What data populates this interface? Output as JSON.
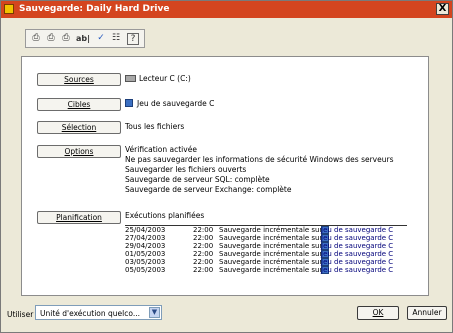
{
  "window": {
    "title": "Sauvegarde: Daily Hard Drive",
    "close": "X"
  },
  "toolbar": {
    "buttons": [
      {
        "icon": "new-icon",
        "glyph": "⎙"
      },
      {
        "icon": "copy-icon",
        "glyph": "⎙"
      },
      {
        "icon": "paste-icon",
        "glyph": "⎙"
      },
      {
        "icon": "rename-icon",
        "glyph": "ab|"
      },
      {
        "icon": "check-icon",
        "glyph": "✓"
      },
      {
        "icon": "properties-icon",
        "glyph": "☷"
      },
      {
        "icon": "help-icon",
        "glyph": "?"
      }
    ]
  },
  "sections": {
    "sources": {
      "button": "Sources",
      "text": "Lecteur C (C:)"
    },
    "cibles": {
      "button": "Cibles",
      "text": "Jeu de sauvegarde C"
    },
    "selection": {
      "button": "Sélection",
      "text": "Tous les fichiers"
    },
    "options": {
      "button": "Options",
      "lines": [
        "Vérification activée",
        "Ne pas sauvegarder les informations de sécurité Windows des serveurs",
        "Sauvegarder les fichiers ouverts",
        "Sauvegarde de serveur SQL: complète",
        "Sauvegarde de serveur Exchange: complète"
      ]
    },
    "planification": {
      "button": "Planification",
      "heading": "Exécutions planifiées",
      "rows": [
        {
          "date": "25/04/2003",
          "time": "22:00",
          "desc": "Sauvegarde incrémentale sur",
          "set": "Jeu de sauvegarde C"
        },
        {
          "date": "27/04/2003",
          "time": "22:00",
          "desc": "Sauvegarde incrémentale sur",
          "set": "Jeu de sauvegarde C"
        },
        {
          "date": "29/04/2003",
          "time": "22:00",
          "desc": "Sauvegarde incrémentale sur",
          "set": "Jeu de sauvegarde C"
        },
        {
          "date": "01/05/2003",
          "time": "22:00",
          "desc": "Sauvegarde incrémentale sur",
          "set": "Jeu de sauvegarde C"
        },
        {
          "date": "03/05/2003",
          "time": "22:00",
          "desc": "Sauvegarde incrémentale sur",
          "set": "Jeu de sauvegarde C"
        },
        {
          "date": "05/05/2003",
          "time": "22:00",
          "desc": "Sauvegarde incrémentale sur",
          "set": "Jeu de sauvegarde C"
        }
      ]
    }
  },
  "footer": {
    "use_label": "Utiliser",
    "combo_value": "Unité d'exécution quelco...",
    "ok": "OK",
    "cancel": "Annuler"
  },
  "colors": {
    "title_bar": "#d4451f",
    "link": "#00007a"
  }
}
